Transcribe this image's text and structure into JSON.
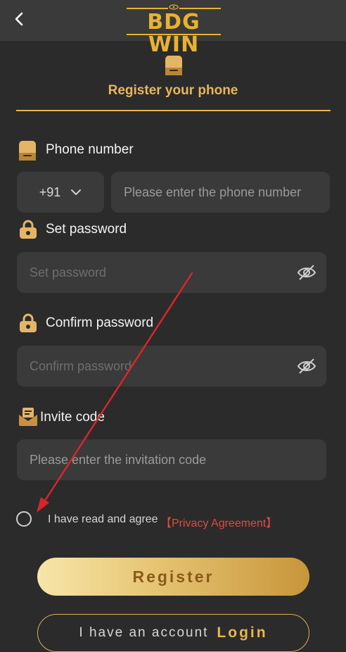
{
  "header": {
    "logo_text": "BDG WIN"
  },
  "tab": {
    "label": "Register your phone"
  },
  "phone": {
    "label": "Phone number",
    "country_code": "+91",
    "placeholder": "Please enter the phone number"
  },
  "password": {
    "label": "Set password",
    "placeholder": "Set password"
  },
  "confirm_password": {
    "label": "Confirm password",
    "placeholder": "Confirm password"
  },
  "invite": {
    "label": "Invite code",
    "placeholder": "Please enter the invitation code"
  },
  "agreement": {
    "text": "I have read and agree",
    "link": "【Privacy Agreement】"
  },
  "actions": {
    "register_label": "Register",
    "login_prefix": "I have an account",
    "login_label": "Login"
  },
  "colors": {
    "accent": "#e8b230",
    "link": "#e04a3f",
    "annotation_arrow": "#d9252a"
  }
}
